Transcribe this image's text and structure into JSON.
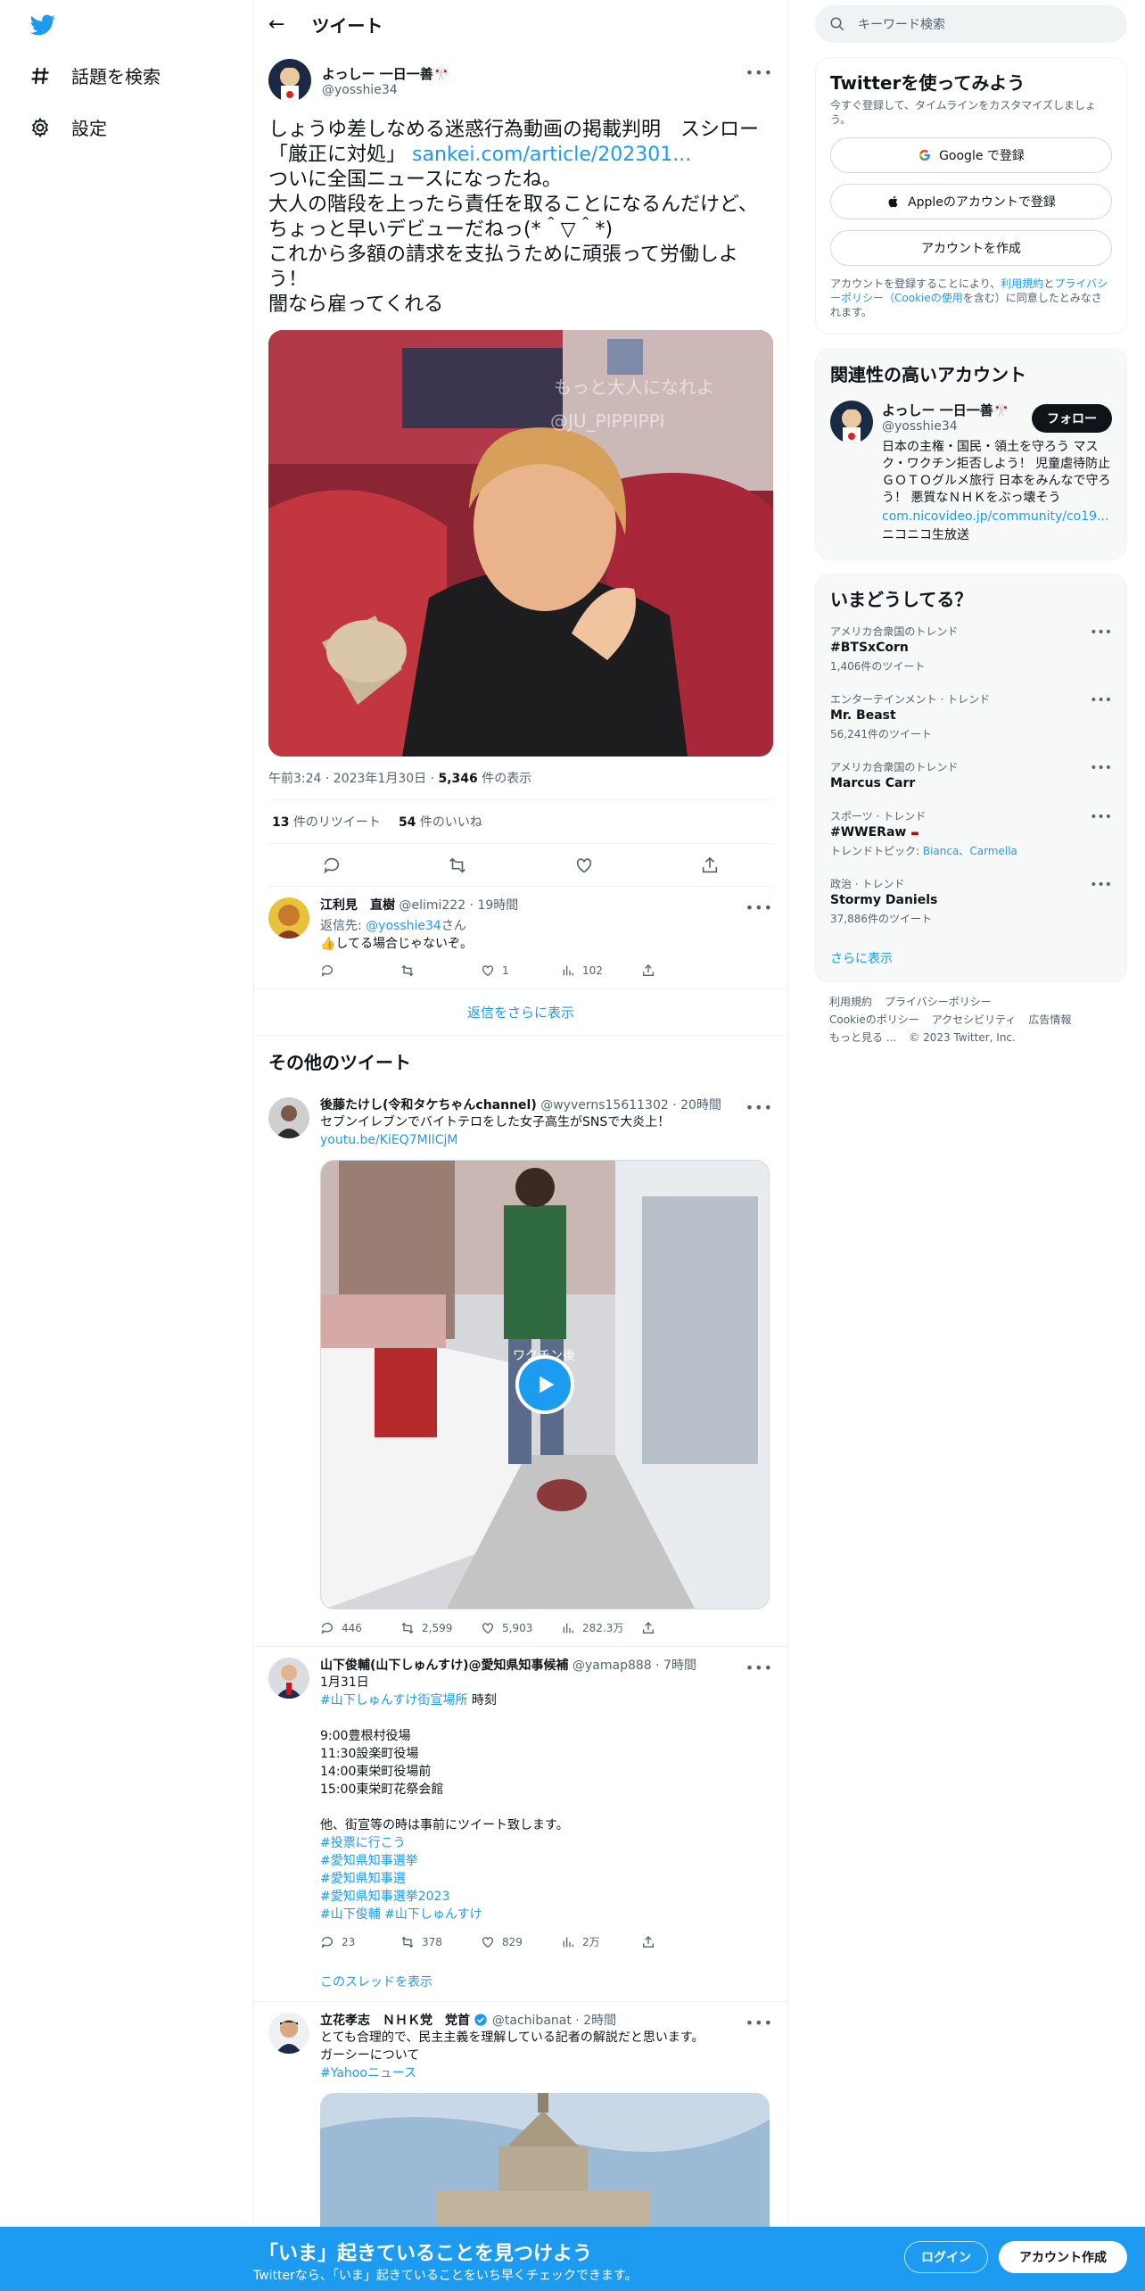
{
  "colors": {
    "accent": "#1d9bf0",
    "text": "#0f1419",
    "muted": "#536471"
  },
  "nav": {
    "logo": "twitter-bird-icon",
    "explore": "話題を検索",
    "settings": "設定"
  },
  "header": {
    "title": "ツイート"
  },
  "focal_tweet": {
    "author_name": "よっしー 一日一善🎌",
    "author_handle": "@yosshie34",
    "text_before_link": "しょうゆ差しなめる迷惑行為動画の掲載判明　スシロー「厳正に対処」 ",
    "link": "sankei.com/article/202301...",
    "text_after_link": "\nついに全国ニュースになったね。\n大人の階段を上ったら責任を取ることになるんだけど、ちょっと早いデビューだねっ(*＾▽＾*)\nこれから多額の請求を支払うために頑張って労働しよう！\n闇なら雇ってくれる",
    "media_watermark_1": "もっと大人になれよ",
    "media_watermark_2": "@JU_PIPPIPPI",
    "timestamp": "午前3:24 · 2023年1月30日 · ",
    "views": "5,346",
    "views_label": " 件の表示",
    "retweets": "13",
    "retweets_label": " 件のリツイート",
    "likes": "54",
    "likes_label": " 件のいいね"
  },
  "reply": {
    "author_name": "江利見　直樹",
    "author_handle": "@elimi222",
    "time": "19時間",
    "reply_to_label": "返信先: ",
    "reply_to": "@yosshie34",
    "reply_to_suffix": "さん",
    "text": "👍してる場合じゃないぞ。",
    "replies": "",
    "retweets": "",
    "likes": "1",
    "views": "102"
  },
  "show_more_replies": "返信をさらに表示",
  "more_tweets_title": "その他のツイート",
  "tweets": [
    {
      "author_name": "後藤たけし(令和タケちゃんchannel)",
      "author_handle": "@wyverns15611302",
      "time": "20時間",
      "text": "セブンイレブンでバイトテロをした女子高生がSNSで大炎上！",
      "link": "youtu.be/KiEQ7MIlCjM",
      "video_caption": "ワクチン後",
      "replies": "446",
      "retweets": "2,599",
      "likes": "5,903",
      "views": "282.3万"
    },
    {
      "author_name": "山下俊輔(山下しゅんすけ)@愛知県知事候補",
      "author_handle": "@yamap888",
      "time": "7時間",
      "line1": "1月31日",
      "hashtag1": "#山下しゅんすけ街宣場所",
      "hashtag1_suffix": " 時刻",
      "schedule": "\n9:00豊根村役場\n11:30設楽町役場\n14:00東栄町役場前\n15:00東栄町花祭会館\n\n他、街宣等の時は事前にツイート致します。\n",
      "tags": "#投票に行こう\n#愛知県知事選挙\n#愛知県知事選\n#愛知県知事選挙2023\n#山下俊輔 #山下しゅんすけ",
      "replies": "23",
      "retweets": "378",
      "likes": "829",
      "views": "2万",
      "thread": "このスレッドを表示"
    },
    {
      "author_name": "立花孝志　ＮＨＫ党　党首",
      "author_handle": "@tachibanat",
      "time": "2時間",
      "text": "とても合理的で、民主主義を理解している記者の解説だと思います。\nガーシーについて",
      "hashtag": "#Yahooニュース"
    }
  ],
  "right": {
    "search_placeholder": "キーワード検索",
    "signup_card": {
      "title": "Twitterを使ってみよう",
      "subtitle": "今すぐ登録して、タイムラインをカスタマイズしましょう。",
      "google": "Google で登録",
      "apple": "Appleのアカウントで登録",
      "create": "アカウントを作成",
      "legal_1": "アカウントを登録することにより、",
      "legal_terms": "利用規約",
      "legal_2": "と",
      "legal_privacy": "プライバシーポリシー",
      "legal_cookie": "（Cookieの使用",
      "legal_3": "を含む）に同意したとみなされます。"
    },
    "related": {
      "title": "関連性の高いアカウント",
      "name": "よっしー 一日一善🎌",
      "handle": "@yosshie34",
      "follow": "フォロー",
      "bio": "日本の主権・国民・領土を守ろう マスク・ワクチン拒否しよう！ 児童虐待防止　ＧＯＴＯグルメ旅行 日本をみんなで守ろう！ 悪質なＮＨＫをぶっ壊そう",
      "link": "com.nicovideo.jp/community/co19...",
      "extra": "ニコニコ生放送"
    },
    "trends": {
      "title": "いまどうしてる？",
      "items": [
        {
          "context": "アメリカ合衆国のトレンド",
          "name": "#BTSxCorn",
          "count": "1,406件のツイート"
        },
        {
          "context": "エンターテインメント · トレンド",
          "name": "Mr. Beast",
          "count": "56,241件のツイート"
        },
        {
          "context": "アメリカ合衆国のトレンド",
          "name": "Marcus Carr",
          "count": ""
        },
        {
          "context": "スポーツ · トレンド",
          "name": "#WWERaw",
          "count_prefix": "トレンドトピック: ",
          "count": "Bianca、Carmella"
        },
        {
          "context": "政治 · トレンド",
          "name": "Stormy Daniels",
          "count": "37,886件のツイート"
        }
      ],
      "show_more": "さらに表示"
    },
    "footer": {
      "terms": "利用規約",
      "privacy": "プライバシーポリシー",
      "cookie": "Cookieのポリシー",
      "accessibility": "アクセシビリティ",
      "ads": "広告情報",
      "more": "もっと見る ...",
      "copyright": "© 2023 Twitter, Inc."
    }
  },
  "bottom_bar": {
    "title": "「いま」起きていることを見つけよう",
    "subtitle": "Twitterなら、「いま」起きていることをいち早くチェックできます。",
    "login": "ログイン",
    "signup": "アカウント作成"
  }
}
